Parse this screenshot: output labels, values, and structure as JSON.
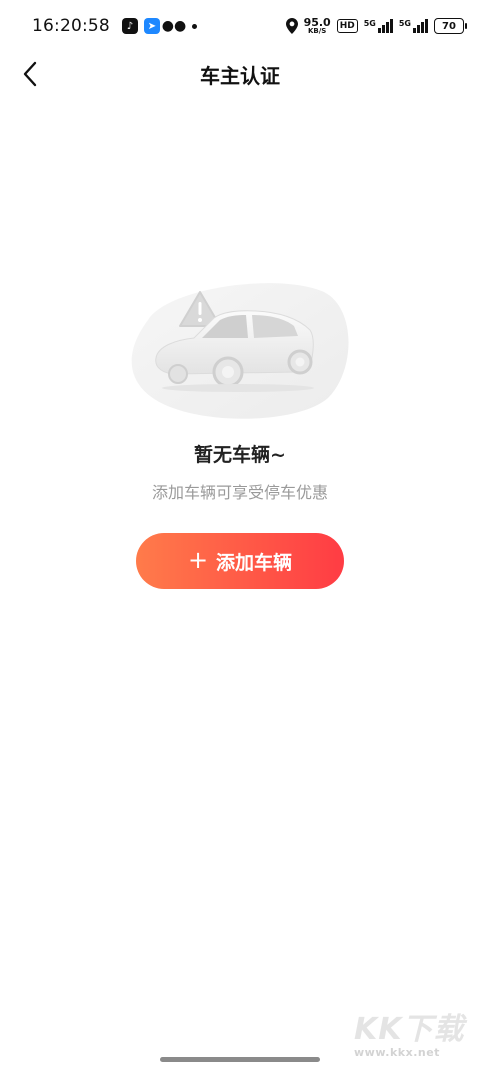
{
  "status_bar": {
    "time": "16:20:58",
    "net_speed_value": "95.0",
    "net_speed_unit": "KB/S",
    "hd_label": "HD",
    "sim1_label": "5G",
    "sim2_label": "5G",
    "battery": "70",
    "app_icons": [
      "tiktok-icon",
      "maps-icon",
      "wechat-icon"
    ]
  },
  "header": {
    "title": "车主认证",
    "back_icon": "chevron-left-icon"
  },
  "empty_state": {
    "illustration": "car-with-warning-illustration",
    "title": "暂无车辆~",
    "subtitle": "添加车辆可享受停车优惠",
    "add_button_icon": "+",
    "add_button_label": "添加车辆"
  },
  "watermark": {
    "main": "KK下载",
    "url": "www.kkx.net"
  },
  "colors": {
    "button_start": "#ff7b4a",
    "button_end": "#ff3c44",
    "subtitle": "#9a9a9a"
  }
}
